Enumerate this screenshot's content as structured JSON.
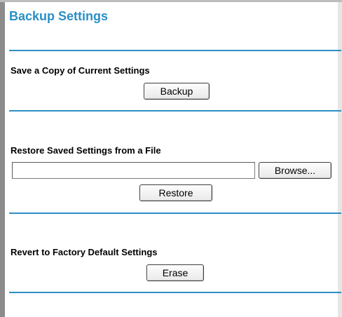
{
  "page": {
    "title": "Backup Settings"
  },
  "backup": {
    "label": "Save a Copy of Current Settings",
    "button_label": "Backup"
  },
  "restore": {
    "label": "Restore Saved Settings from a File",
    "file_value": "",
    "browse_label": "Browse...",
    "button_label": "Restore"
  },
  "revert": {
    "label": "Revert to Factory Default Settings",
    "button_label": "Erase"
  },
  "colors": {
    "accent": "#2b8fc5",
    "text": "#000000"
  }
}
